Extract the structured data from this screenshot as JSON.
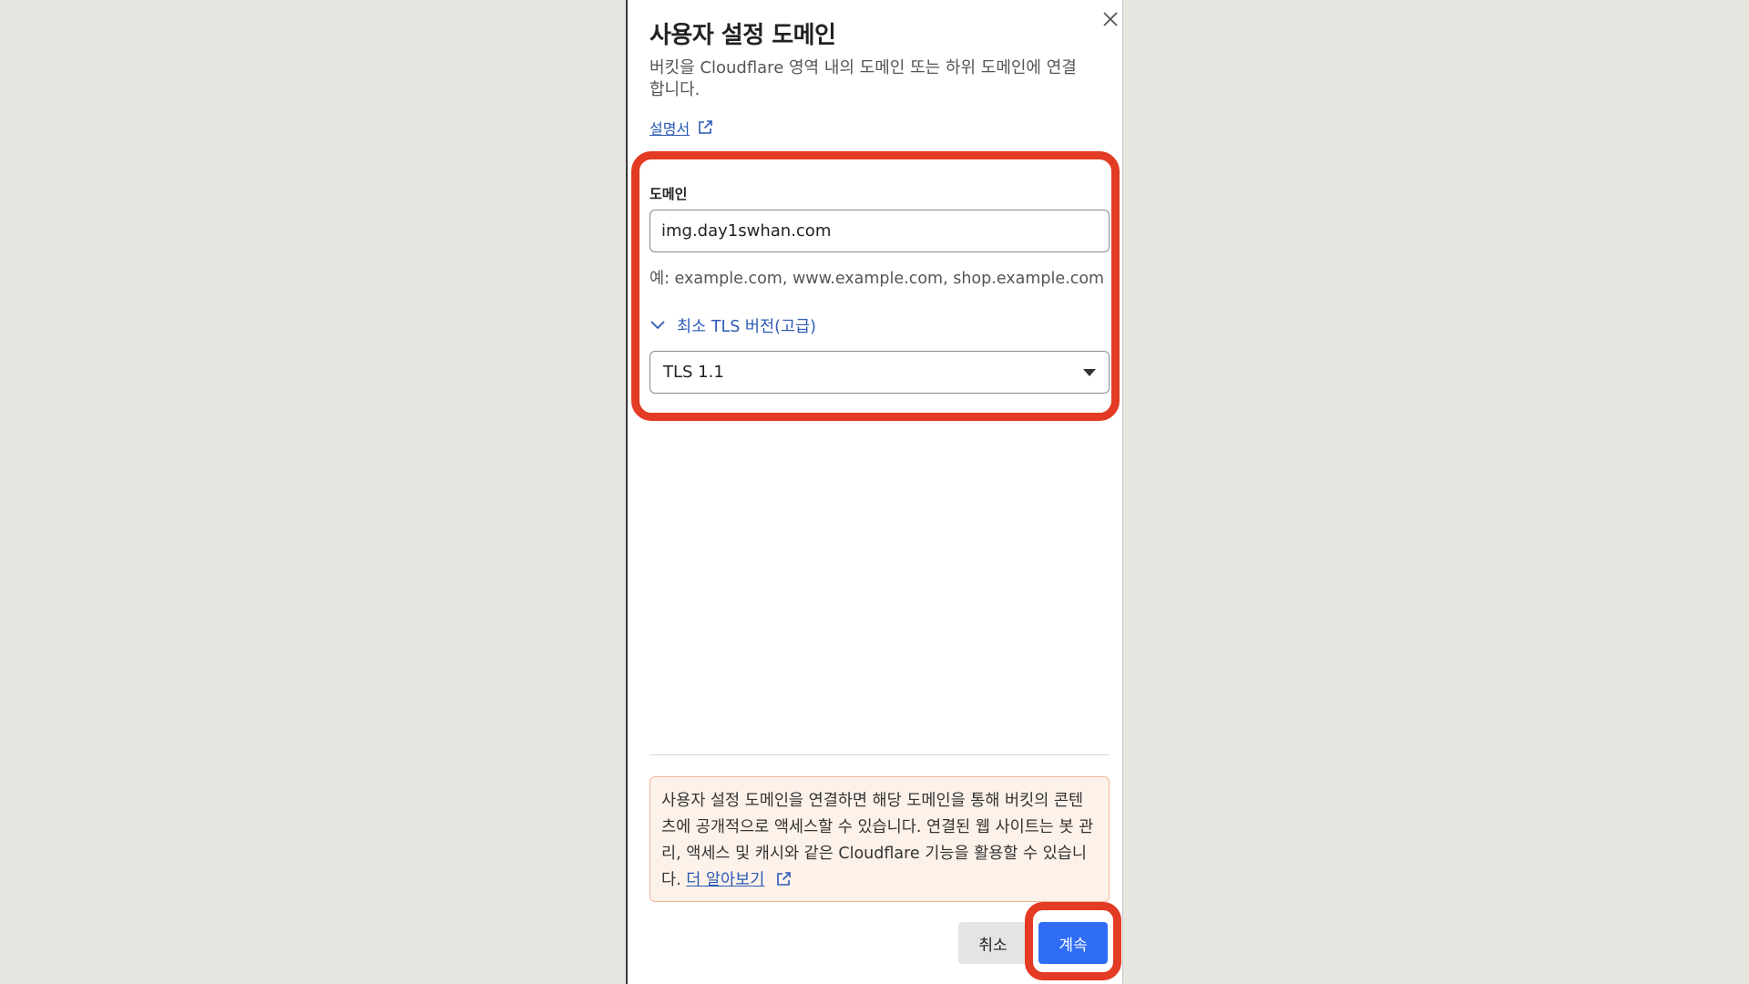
{
  "dialog": {
    "title": "사용자 설정 도메인",
    "description": "버킷을 Cloudflare 영역 내의 도메인 또는 하위 도메인에 연결합니다.",
    "doc_link": "설명서",
    "close_icon": "close-icon"
  },
  "form": {
    "domain_label": "도메인",
    "domain_value": "img.day1swhan.com",
    "domain_hint": "예: example.com, www.example.com, shop.example.com",
    "tls_toggle_label": "최소 TLS 버전(고급)",
    "tls_selected": "TLS 1.1"
  },
  "notice": {
    "text": "사용자 설정 도메인을 연결하면 해당 도메인을 통해 버킷의 콘텐츠에 공개적으로 액세스할 수 있습니다. 연결된 웹 사이트는 봇 관리, 액세스 및 캐시와 같은 Cloudflare 기능을 활용할 수 있습니다.",
    "link": "더 알아보기"
  },
  "footer": {
    "cancel_label": "취소",
    "continue_label": "계속"
  },
  "colors": {
    "accent": "#2f6df6",
    "link": "#2c5ab5",
    "highlight": "#e33b24",
    "notice_bg": "#fdf2ea"
  }
}
